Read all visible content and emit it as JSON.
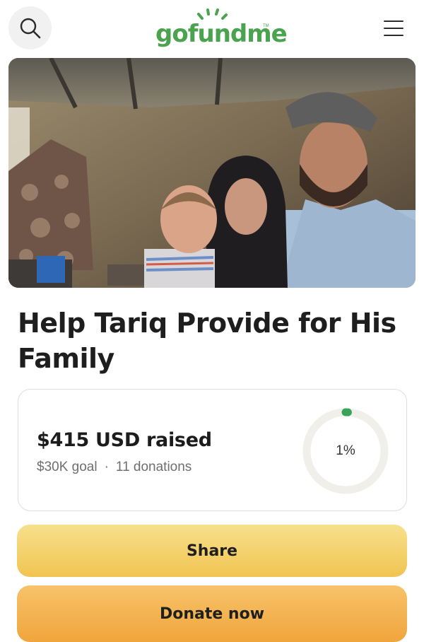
{
  "header": {
    "logo_text": "gofundme",
    "logo_tm": "TM",
    "search_icon": "search-icon",
    "menu_icon": "hamburger-menu-icon"
  },
  "campaign": {
    "title": "Help Tariq Provide for His Family",
    "hero_image": "family-photo"
  },
  "progress": {
    "raised": "$415 USD raised",
    "goal": "$30K goal",
    "separator": "·",
    "donations": "11 donations",
    "percent_label": "1%",
    "percent_value": 1,
    "ring_color": "#f0efe9",
    "fill_color": "#3aa35a"
  },
  "actions": {
    "share_label": "Share",
    "donate_label": "Donate now"
  },
  "colors": {
    "brand": "#4aa34f",
    "share_button": "#f4d26e",
    "donate_button": "#f2b04d"
  }
}
